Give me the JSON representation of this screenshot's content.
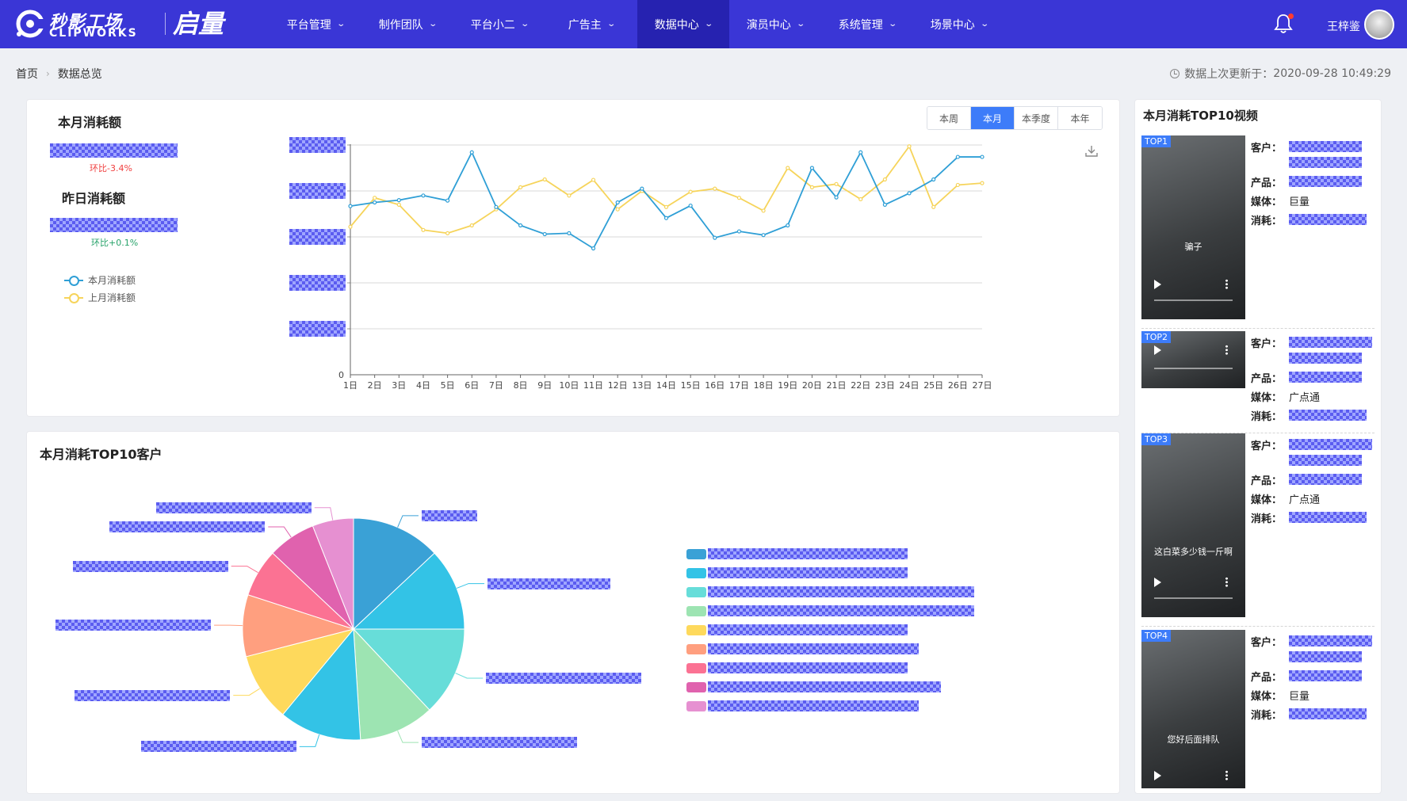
{
  "brand": {
    "logo_cn": "秒影工场",
    "logo_en": "CLIPWORKS",
    "product": "启量"
  },
  "nav": [
    {
      "label": "平台管理",
      "active": false
    },
    {
      "label": "制作团队",
      "active": false
    },
    {
      "label": "平台小二",
      "active": false
    },
    {
      "label": "广告主",
      "active": false
    },
    {
      "label": "数据中心",
      "active": true
    },
    {
      "label": "演员中心",
      "active": false
    },
    {
      "label": "系统管理",
      "active": false
    },
    {
      "label": "场景中心",
      "active": false
    }
  ],
  "user": {
    "name": "王梓鉴",
    "has_notification": true
  },
  "breadcrumb": {
    "home": "首页",
    "current": "数据总览"
  },
  "updated": {
    "label": "数据上次更新于：",
    "time": "2020-09-28 10:49:29"
  },
  "consume": {
    "month_title": "本月消耗额",
    "month_ratio": "环比-3.4%",
    "yesterday_title": "昨日消耗额",
    "yesterday_ratio": "环比+0.1%",
    "legend": [
      {
        "name": "本月消耗额",
        "color": "#2f9fd6"
      },
      {
        "name": "上月消耗额",
        "color": "#f6d45b"
      }
    ],
    "ranges": [
      {
        "label": "本周",
        "active": false
      },
      {
        "label": "本月",
        "active": true
      },
      {
        "label": "本季度",
        "active": false
      },
      {
        "label": "本年",
        "active": false
      }
    ]
  },
  "chart_data": {
    "type": "line",
    "x": [
      "1日",
      "2日",
      "3日",
      "4日",
      "5日",
      "6日",
      "7日",
      "8日",
      "9日",
      "10日",
      "11日",
      "12日",
      "13日",
      "14日",
      "15日",
      "16日",
      "17日",
      "18日",
      "19日",
      "20日",
      "21日",
      "22日",
      "23日",
      "24日",
      "25日",
      "26日",
      "27日"
    ],
    "y_zero_label": "0",
    "ylim": [
      0,
      5
    ],
    "grid": true,
    "series": [
      {
        "name": "本月消耗额",
        "color": "#2f9fd6",
        "values": [
          3.67,
          3.75,
          3.8,
          3.9,
          3.79,
          4.84,
          3.65,
          3.25,
          3.06,
          3.08,
          2.75,
          3.75,
          4.05,
          3.41,
          3.68,
          2.98,
          3.12,
          3.04,
          3.25,
          4.5,
          3.86,
          4.84,
          3.7,
          3.95,
          4.25,
          4.74,
          4.74
        ]
      },
      {
        "name": "上月消耗额",
        "color": "#f6d45b",
        "values": [
          3.22,
          3.85,
          3.7,
          3.15,
          3.08,
          3.25,
          3.6,
          4.08,
          4.25,
          3.9,
          4.24,
          3.6,
          4.0,
          3.65,
          3.98,
          4.05,
          3.85,
          3.57,
          4.5,
          4.08,
          4.15,
          3.82,
          4.25,
          4.97,
          3.65,
          4.13,
          4.17
        ]
      }
    ]
  },
  "pie": {
    "title": "本月消耗TOP10客户",
    "slices": [
      {
        "value": 13,
        "color": "#3aa1d6"
      },
      {
        "value": 12,
        "color": "#33c3e6"
      },
      {
        "value": 13,
        "color": "#67ddd9"
      },
      {
        "value": 11,
        "color": "#9de4b2"
      },
      {
        "value": 12,
        "color": "#33c3e6"
      },
      {
        "value": 10,
        "color": "#fed95c"
      },
      {
        "value": 9,
        "color": "#ff9f7f"
      },
      {
        "value": 7,
        "color": "#fb7293"
      },
      {
        "value": 7,
        "color": "#e062ae"
      },
      {
        "value": 6,
        "color": "#e690d1"
      }
    ],
    "legend_colors": [
      "#3aa1d6",
      "#33c3e6",
      "#67ddd9",
      "#9de4b2",
      "#fed95c",
      "#ff9f7f",
      "#fb7293",
      "#e062ae",
      "#e690d1"
    ]
  },
  "top10": {
    "title": "本月消耗TOP10视频",
    "labels": {
      "customer": "客户：",
      "product": "产品：",
      "media": "媒体：",
      "consume": "消耗："
    },
    "items": [
      {
        "rank": "TOP1",
        "media": "巨量",
        "caption": "骗子"
      },
      {
        "rank": "TOP2",
        "media": "广点通",
        "caption": ""
      },
      {
        "rank": "TOP3",
        "media": "广点通",
        "caption": "这白菜多少钱一斤啊"
      },
      {
        "rank": "TOP4",
        "media": "巨量",
        "caption": "您好后面排队"
      }
    ]
  }
}
